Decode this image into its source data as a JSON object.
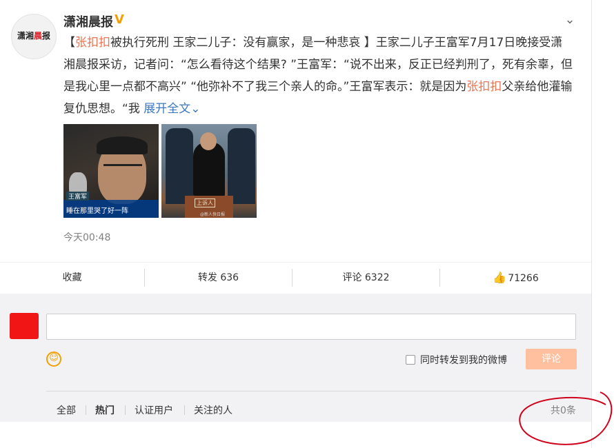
{
  "post": {
    "author": "潇湘晨报",
    "avatar_logo_left": "潇湘",
    "avatar_logo_mid": "晨",
    "avatar_logo_right": "报",
    "text_open": "【",
    "text_hl1": "张扣扣",
    "text_part1": "被执行死刑 王家二儿子：没有赢家，是一种悲哀 】王家二儿子王富军7月17日晚接受潇湘晨报采访，记者问：“怎么看待这个结果? ”王富军：“说不出来，反正已经判刑了，死有余辜，但是我心里一点都不高兴” “他弥补不了我三个亲人的命。”王富军表示：就是因为",
    "text_hl2": "张扣扣",
    "text_part2": "父亲给他灌输复仇思想。“我",
    "expand_label": "展开全文",
    "time": "今天00:48",
    "image1_caption_name": "王富军",
    "image1_caption_text": "睡在那里哭了好一阵",
    "image2_dock_label": "上诉人",
    "image2_watermark": "@新人快日报"
  },
  "actions": {
    "favorite": "收藏",
    "repost": "转发 636",
    "comment": "评论 6322",
    "like_count": "71266"
  },
  "comment_box": {
    "placeholder": "",
    "also_repost_label": "同时转发到我的微博",
    "submit_label": "评论"
  },
  "filters": {
    "all": "全部",
    "hot": "热门",
    "verified": "认证用户",
    "following": "关注的人",
    "count": "共0条"
  },
  "colors": {
    "highlight": "#eb7350",
    "link": "#3c78c0",
    "submit_disabled": "#ffc09f",
    "annotation": "#d0021b",
    "redaction": "#f21515"
  },
  "icons": [
    "verified-v-icon",
    "chevron-down-icon",
    "thumbs-up-icon",
    "smiley-icon",
    "checkbox-icon"
  ]
}
